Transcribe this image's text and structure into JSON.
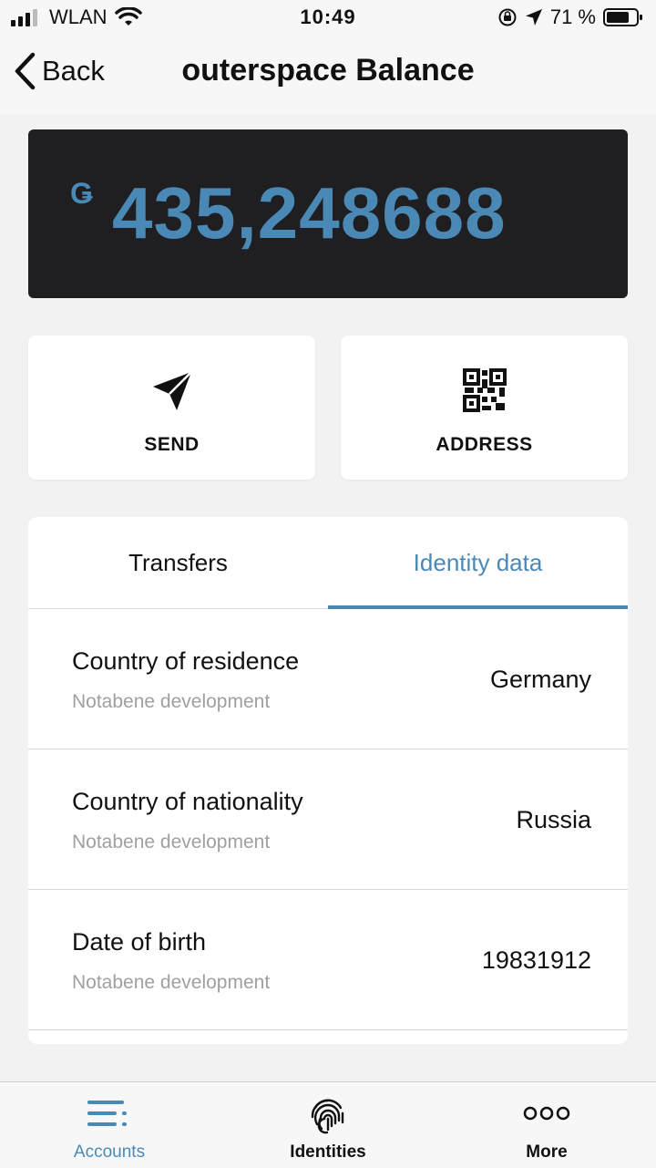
{
  "status_bar": {
    "carrier": "WLAN",
    "time": "10:49",
    "battery": "71 %"
  },
  "nav": {
    "back_label": "Back",
    "title": "outerspace Balance"
  },
  "balance": {
    "currency_symbol": "Ǥ",
    "amount": "435,248688"
  },
  "actions": {
    "send_label": "SEND",
    "address_label": "ADDRESS"
  },
  "tabs": {
    "transfers": "Transfers",
    "identity": "Identity data",
    "active": "Identity data"
  },
  "identity_rows": [
    {
      "label": "Country of residence",
      "source": "Notabene development",
      "value": "Germany"
    },
    {
      "label": "Country of nationality",
      "source": "Notabene development",
      "value": "Russia"
    },
    {
      "label": "Date of birth",
      "source": "Notabene development",
      "value": "19831912"
    }
  ],
  "bottom_tabs": {
    "accounts": "Accounts",
    "identities": "Identities",
    "more": "More",
    "active": "Accounts"
  },
  "colors": {
    "accent": "#4a89b6",
    "card_bg": "#1f1f22",
    "page_bg": "#f2f2f3"
  }
}
